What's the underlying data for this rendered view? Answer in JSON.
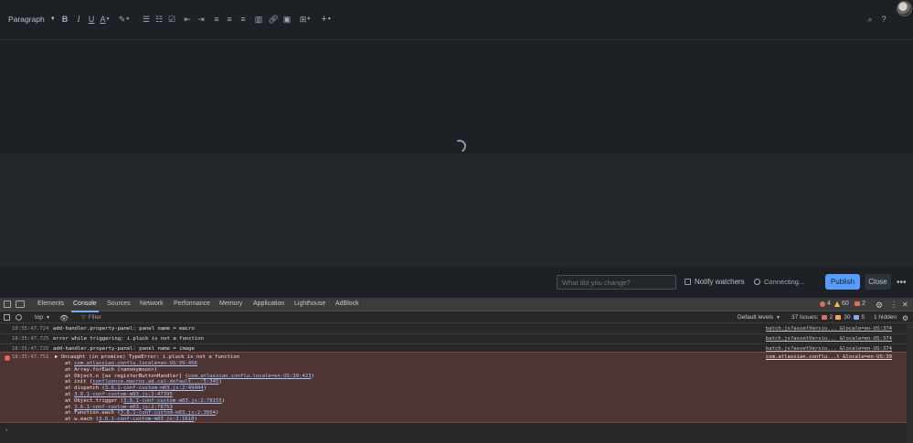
{
  "editor": {
    "paragraph_label": "Paragraph",
    "toolbar_icons": [
      "bold-icon",
      "italic-icon",
      "underline-icon",
      "text-color-icon",
      "text-style-icon",
      "bullet-list-icon",
      "numbered-list-icon",
      "task-list-icon",
      "outdent-icon",
      "indent-icon",
      "align-left-icon",
      "align-center-icon",
      "align-right-icon",
      "layout-icon",
      "link-icon",
      "image-icon",
      "table-icon",
      "insert-plus-icon",
      "find-icon",
      "help-icon"
    ]
  },
  "publish_bar": {
    "change_placeholder": "What did you change?",
    "notify_label": "Notify watchers",
    "status_text": "Connecting...",
    "publish_label": "Publish",
    "close_label": "Close",
    "more_label": "•••"
  },
  "devtools": {
    "tabs": [
      "Elements",
      "Console",
      "Sources",
      "Network",
      "Performance",
      "Memory",
      "Application",
      "Lighthouse",
      "AdBlock"
    ],
    "active_tab": "Console",
    "counts": {
      "errors": "4",
      "warnings": "60",
      "issues_red": "2"
    },
    "filter": {
      "context": "top",
      "placeholder": "Filter",
      "levels": "Default levels",
      "issues_label": "37 Issues:",
      "issue_err": "2",
      "issue_warn": "30",
      "issue_info": "5",
      "hidden": "1 hidden"
    },
    "logs": [
      {
        "ts": "18:35:47.724",
        "msg": "add-handler.property-panel: panel name = macro",
        "src": "batch.js?assetVersio..._&locale=en-US:374"
      },
      {
        "ts": "18:35:47.725",
        "msg": "error while triggering: i.pluck is not a function",
        "src": "batch.js?assetVersio..._&locale=en-US:374"
      },
      {
        "ts": "18:35:47.725",
        "msg": "add-handler.property-panel: panel name = image",
        "src": "batch.js?assetVersio..._&locale=en-US:374"
      }
    ],
    "error": {
      "ts": "18:35:47.751",
      "head": "▶ Uncaught (in promise) TypeError: i.pluck is not a function",
      "src": "com.atlassian.conflu...t_&locale=en-US:39",
      "trace": [
        {
          "pre": "at ",
          "link": "com.atlassian.conflu.locale=en-US:39:456",
          "post": ""
        },
        {
          "pre": "at Array.forEach (<anonymous>)",
          "link": "",
          "post": ""
        },
        {
          "pre": "at Object.o [as registerButtonHandler] (",
          "link": "com.atlassian.conflu.locale=en-US:39:423",
          "post": ")"
        },
        {
          "pre": "at init (",
          "link": "confluence.macros.ad.cal-default...:5:345",
          "post": ")"
        },
        {
          "pre": "at dispatch (",
          "link": "3.6.1-conf-custom-m03.js:2:49404",
          "post": ")"
        },
        {
          "pre": "at ",
          "link": "3.6.1-conf-custom-m03.js:2:47395",
          "post": ""
        },
        {
          "pre": "at Object.trigger (",
          "link": "3.6.1-conf-custom-m03.js:2:78155",
          "post": ")"
        },
        {
          "pre": "at ",
          "link": "3.6.1-conf-custom-m03.js:2:78753",
          "post": ""
        },
        {
          "pre": "at Function.each (",
          "link": "3.6.1-conf-custom-m03.js:2:3664",
          "post": ")"
        },
        {
          "pre": "at w.each (",
          "link": "3.6.1-conf-custom-m03.js:2:1610",
          "post": ")"
        }
      ]
    },
    "prompt": "›"
  }
}
